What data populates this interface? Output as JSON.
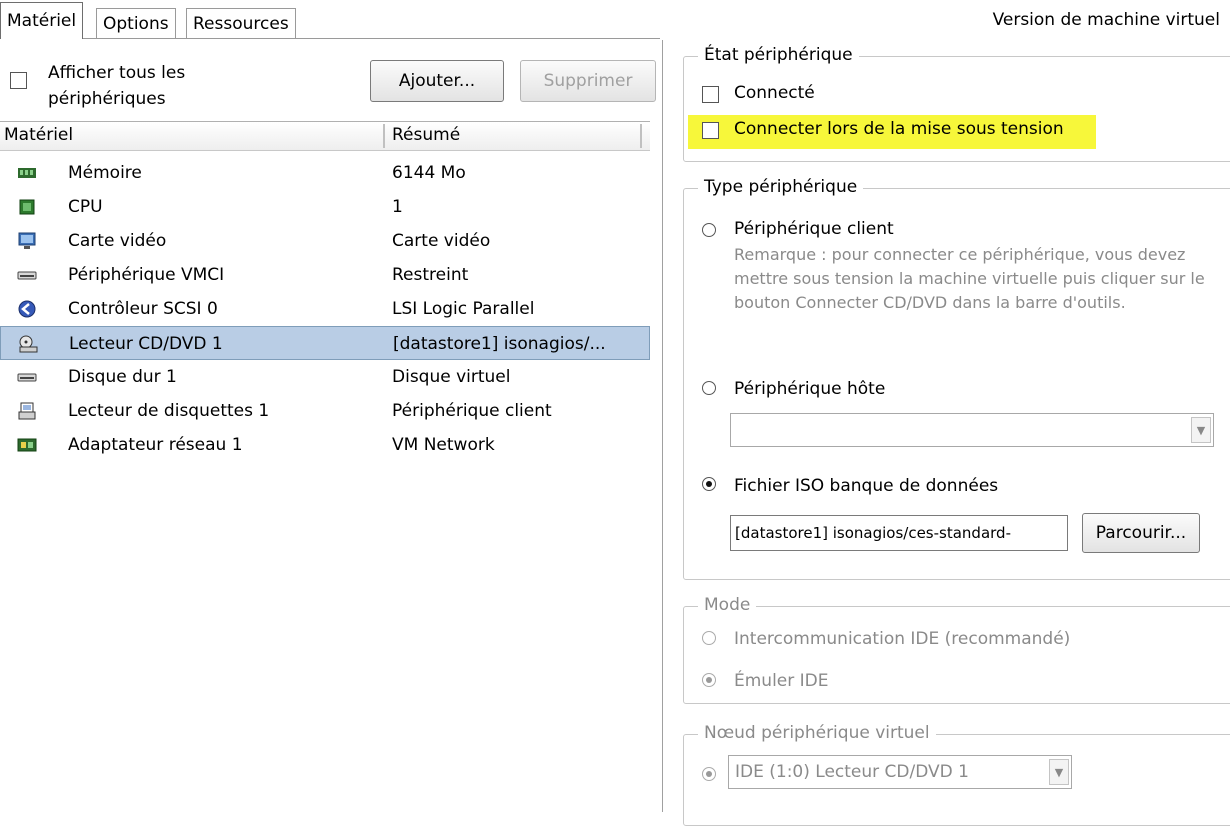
{
  "tabs": [
    "Matériel",
    "Options",
    "Ressources"
  ],
  "version_label": "Version de machine virtuel",
  "left": {
    "show_all_label_line1": "Afficher tous les",
    "show_all_label_line2": "périphériques",
    "add_button": "Ajouter...",
    "remove_button": "Supprimer",
    "columns": [
      "Matériel",
      "Résumé"
    ],
    "rows": [
      {
        "icon": "memory-icon",
        "name": "Mémoire",
        "summary": "6144 Mo"
      },
      {
        "icon": "cpu-icon",
        "name": "CPU",
        "summary": "1"
      },
      {
        "icon": "monitor-icon",
        "name": "Carte vidéo",
        "summary": "Carte vidéo"
      },
      {
        "icon": "vmci-device-icon",
        "name": "Périphérique VMCI",
        "summary": "Restreint"
      },
      {
        "icon": "scsi-controller-icon",
        "name": "Contrôleur SCSI 0",
        "summary": "LSI Logic Parallel"
      },
      {
        "icon": "cd-dvd-drive-icon",
        "name": "Lecteur CD/DVD 1",
        "summary": "[datastore1] isonagios/..."
      },
      {
        "icon": "hard-disk-icon",
        "name": "Disque dur 1",
        "summary": "Disque virtuel"
      },
      {
        "icon": "floppy-drive-icon",
        "name": "Lecteur de disquettes 1",
        "summary": "Périphérique client"
      },
      {
        "icon": "network-adapter-icon",
        "name": "Adaptateur réseau 1",
        "summary": "VM Network"
      }
    ],
    "selected_index": 5
  },
  "right": {
    "device_state": {
      "title": "État périphérique",
      "connected": "Connecté",
      "connect_at_power_on": "Connecter lors de la mise sous tension"
    },
    "device_type": {
      "title": "Type périphérique",
      "client_device": "Périphérique client",
      "note": "Remarque : pour connecter ce périphérique, vous devez mettre sous tension la machine virtuelle puis cliquer sur le bouton Connecter CD/DVD dans la barre d'outils.",
      "host_device": "Périphérique hôte",
      "host_device_value": "",
      "datastore_iso": "Fichier ISO banque de données",
      "iso_path": "[datastore1] isonagios/ces-standard-",
      "browse_button": "Parcourir..."
    },
    "mode": {
      "title": "Mode",
      "ide_passthrough": "Intercommunication IDE (recommandé)",
      "emulate_ide": "Émuler IDE"
    },
    "virtual_node": {
      "title": "Nœud périphérique virtuel",
      "value": "IDE (1:0) Lecteur CD/DVD 1"
    }
  },
  "colors": {
    "selection": "#b9cde5",
    "highlight": "#f7f73a",
    "disabled_text": "#8a8a8a"
  }
}
